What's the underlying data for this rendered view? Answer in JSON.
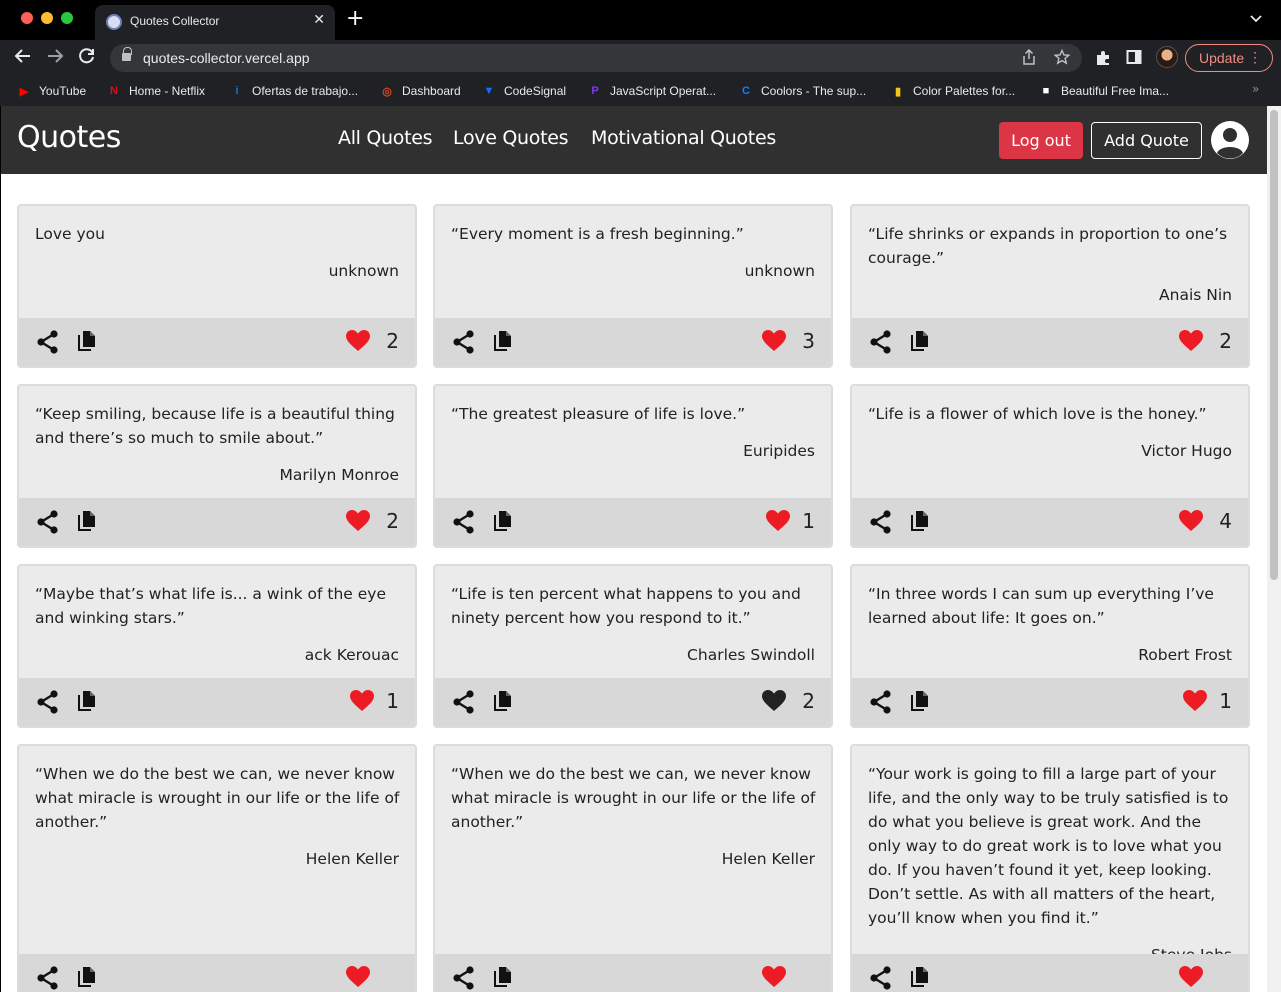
{
  "browser": {
    "tab_title": "Quotes Collector",
    "tab_close": "✕",
    "new_tab": "+",
    "url": "quotes-collector.vercel.app",
    "update_label": "Update",
    "bookmarks": [
      {
        "label": "YouTube",
        "icon": "youtube-icon",
        "color": "#ff0000",
        "glyph": "▶"
      },
      {
        "label": "Home - Netflix",
        "icon": "netflix-icon",
        "color": "#e50914",
        "glyph": "N"
      },
      {
        "label": "Ofertas de trabajo...",
        "icon": "jobs-icon",
        "color": "#1d6fd6",
        "glyph": "i"
      },
      {
        "label": "Dashboard",
        "icon": "dashboard-icon",
        "color": "#e8461f",
        "glyph": "◎"
      },
      {
        "label": "CodeSignal",
        "icon": "codesignal-icon",
        "color": "#1a6aff",
        "glyph": "▼"
      },
      {
        "label": "JavaScript Operat...",
        "icon": "javascript-icon",
        "color": "#7c3aed",
        "glyph": "P"
      },
      {
        "label": "Coolors - The sup...",
        "icon": "coolors-icon",
        "color": "#0a84ff",
        "glyph": "C"
      },
      {
        "label": "Color Palettes for...",
        "icon": "palette-icon",
        "color": "#f5c518",
        "glyph": "▮"
      },
      {
        "label": "Beautiful Free Ima...",
        "icon": "unsplash-icon",
        "color": "#ffffff",
        "glyph": "■"
      }
    ]
  },
  "app": {
    "brand": "Quotes",
    "nav": [
      "All Quotes",
      "Love Quotes",
      "Motivational Quotes"
    ],
    "logout_label": "Log out",
    "add_label": "Add Quote"
  },
  "colors": {
    "heart_liked": "#ed1c24",
    "heart_unliked": "#222222",
    "logout_bg": "#dc3545",
    "navbar_bg": "#303030"
  },
  "quotes": [
    {
      "text": "Love you",
      "author": "unknown",
      "likes": "2",
      "liked": true
    },
    {
      "text": "“Every moment is a fresh beginning.”",
      "author": "unknown",
      "likes": "3",
      "liked": true
    },
    {
      "text": "“Life shrinks or expands in proportion to one’s courage.”",
      "author": "Anais Nin",
      "likes": "2",
      "liked": true
    },
    {
      "text": "“Keep smiling, because life is a beautiful thing and there’s so much to smile about.”",
      "author": "Marilyn Monroe",
      "likes": "2",
      "liked": true
    },
    {
      "text": "“The greatest pleasure of life is love.”",
      "author": "Euripides",
      "likes": "1",
      "liked": true
    },
    {
      "text": "“Life is a flower of which love is the honey.”",
      "author": "Victor Hugo",
      "likes": "4",
      "liked": true
    },
    {
      "text": "“Maybe that’s what life is... a wink of the eye and winking stars.”",
      "author": "ack Kerouac",
      "likes": "1",
      "liked": true
    },
    {
      "text": "“Life is ten percent what happens to you and ninety percent how you respond to it.”",
      "author": "Charles Swindoll",
      "likes": "2",
      "liked": false
    },
    {
      "text": "“In three words I can sum up everything I’ve learned about life: It goes on.”",
      "author": "Robert Frost",
      "likes": "1",
      "liked": true
    },
    {
      "text": "“When we do the best we can, we never know what miracle is wrought in our life or the life of another.”",
      "author": "Helen Keller",
      "likes": "",
      "liked": true
    },
    {
      "text": "“When we do the best we can, we never know what miracle is wrought in our life or the life of another.”",
      "author": "Helen Keller",
      "likes": "",
      "liked": true
    },
    {
      "text": "“Your work is going to fill a large part of your life, and the only way to be truly satisfied is to do what you believe is great work. And the only way to do great work is to love what you do. If you haven’t found it yet, keep looking. Don’t settle. As with all matters of the heart, you’ll know when you find it.”",
      "author": "Steve Jobs",
      "likes": "",
      "liked": true
    }
  ]
}
